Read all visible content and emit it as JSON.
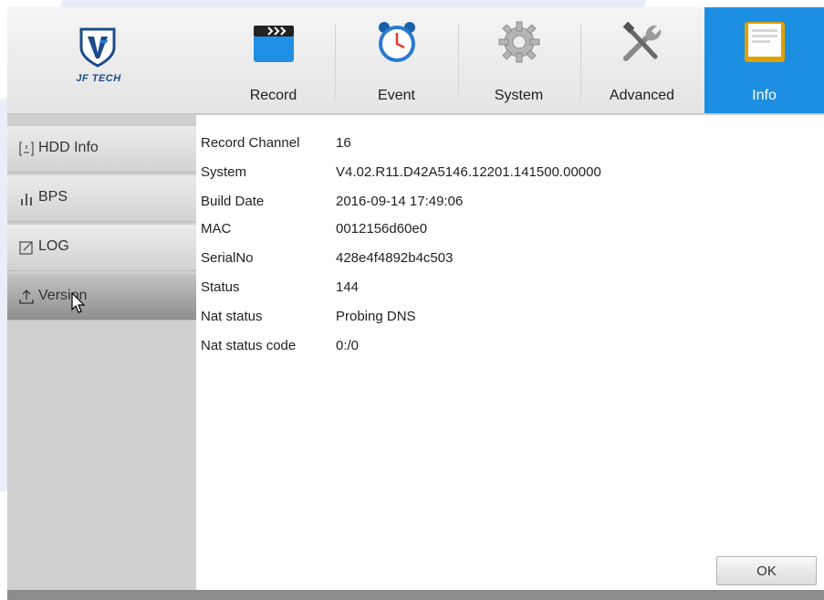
{
  "brand": {
    "logo_text": "JF TECH"
  },
  "tabs": [
    {
      "label": "Record",
      "icon": "clapperboard-icon"
    },
    {
      "label": "Event",
      "icon": "alarm-clock-icon"
    },
    {
      "label": "System",
      "icon": "gear-icon"
    },
    {
      "label": "Advanced",
      "icon": "tools-icon"
    },
    {
      "label": "Info",
      "icon": "document-icon",
      "active": true
    }
  ],
  "sidebar": {
    "items": [
      {
        "label": "HDD Info",
        "icon": "hdd-icon"
      },
      {
        "label": "BPS",
        "icon": "bar-chart-icon"
      },
      {
        "label": "LOG",
        "icon": "log-icon"
      },
      {
        "label": "Version",
        "icon": "upload-icon",
        "active": true
      }
    ]
  },
  "version_info": [
    {
      "key": "Record Channel",
      "value": "16"
    },
    {
      "key": "System",
      "value": "V4.02.R11.D42A5146.12201.141500.00000"
    },
    {
      "key": "Build Date",
      "value": "2016-09-14 17:49:06"
    },
    {
      "key": "MAC",
      "value": "0012156d60e0"
    },
    {
      "key": "SerialNo",
      "value": "428e4f4892b4c503"
    },
    {
      "key": "Status",
      "value": "144"
    },
    {
      "key": "Nat status",
      "value": "Probing DNS"
    },
    {
      "key": "Nat status code",
      "value": "0:/0"
    }
  ],
  "buttons": {
    "ok_label": "OK"
  },
  "colors": {
    "accent": "#1c8fe3",
    "sidebar_active": "#9a9a9a"
  }
}
